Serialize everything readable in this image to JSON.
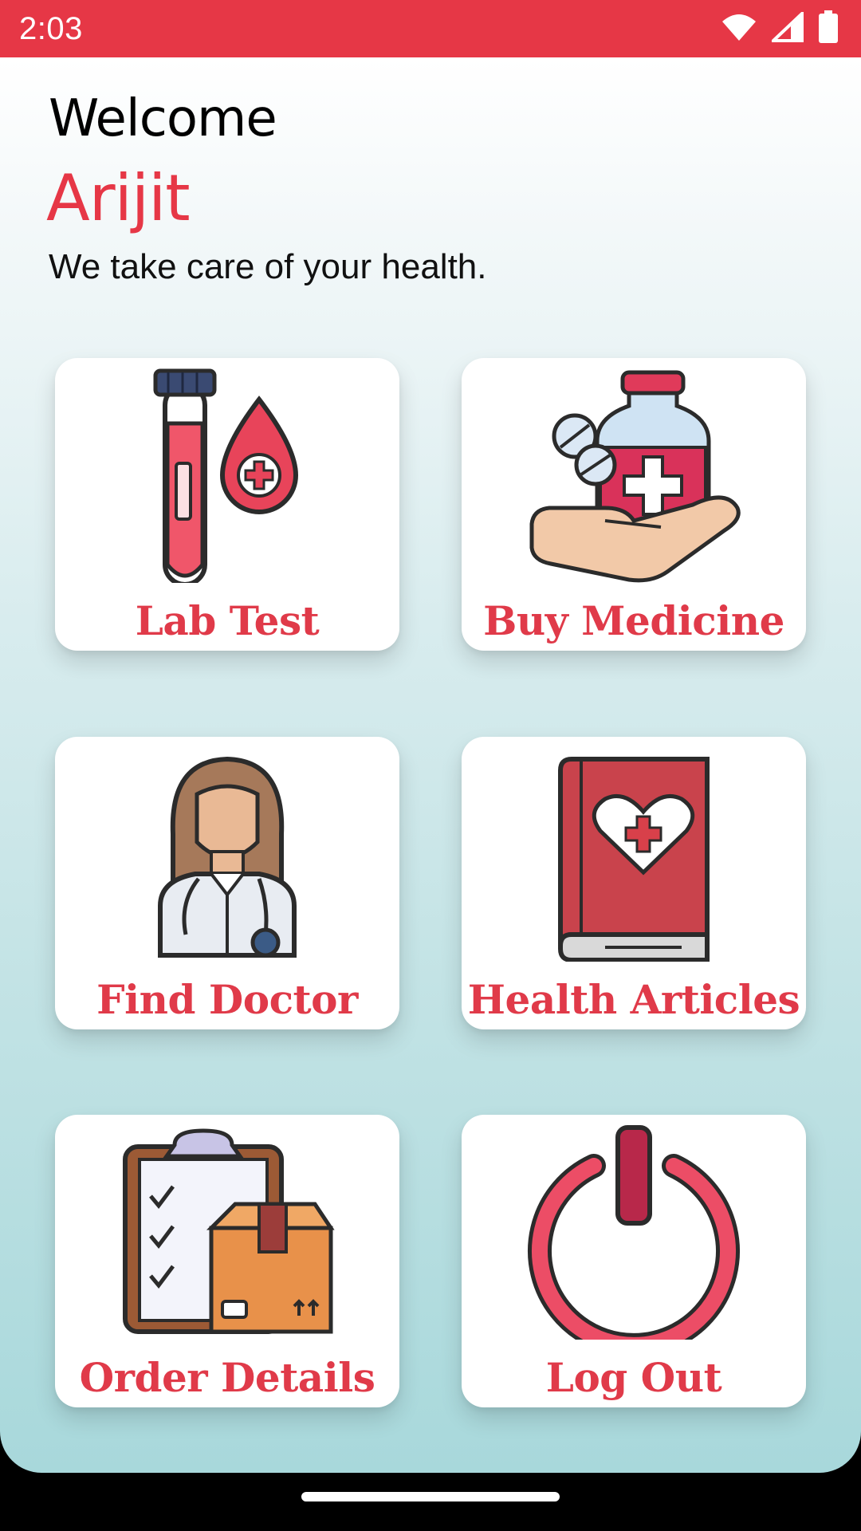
{
  "status_bar": {
    "time": "2:03",
    "icons": [
      "wifi-icon",
      "signal-icon",
      "battery-icon"
    ],
    "background": "#e63746"
  },
  "header": {
    "welcome": "Welcome",
    "user_name": "Arijit",
    "tagline": "We take care of your health."
  },
  "menu": [
    {
      "label": "Lab Test",
      "icon": "test-tube-blood-icon"
    },
    {
      "label": "Buy Medicine",
      "icon": "medicine-hand-icon"
    },
    {
      "label": "Find Doctor",
      "icon": "doctor-icon"
    },
    {
      "label": "Health Articles",
      "icon": "health-book-icon"
    },
    {
      "label": "Order Details",
      "icon": "clipboard-box-icon"
    },
    {
      "label": "Log Out",
      "icon": "power-icon"
    }
  ],
  "colors": {
    "accent": "#e63746",
    "label": "#e03a49"
  }
}
